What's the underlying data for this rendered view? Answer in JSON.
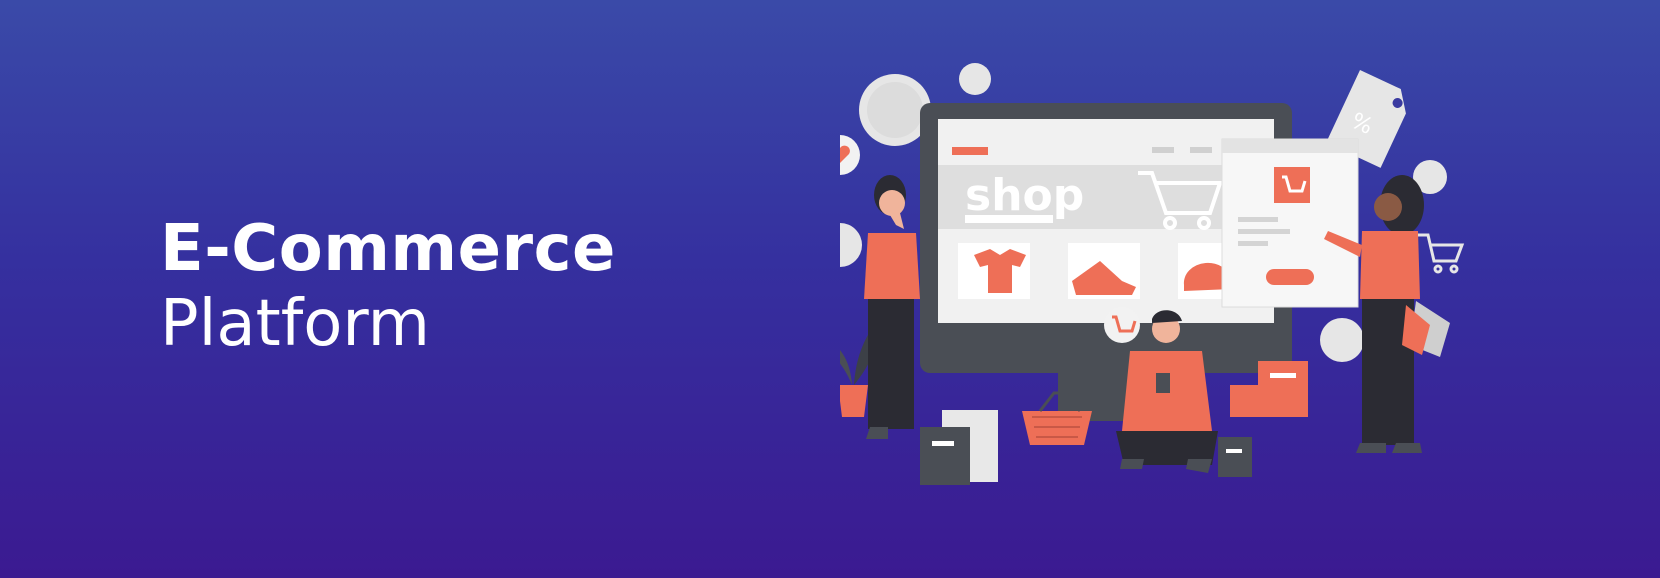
{
  "headline": {
    "title": "E-Commerce",
    "subtitle": "Platform"
  },
  "illustration": {
    "screen_word": "shop"
  },
  "colors": {
    "background_top": "#3a4aa8",
    "background_bottom": "#3b1a91",
    "accent": "#ee6f57",
    "monitor": "#4a4e55",
    "screen": "#f1f1f1"
  },
  "icons": [
    "heart-icon",
    "cart-icon",
    "price-tag-icon",
    "shopping-basket-icon",
    "plant-icon",
    "shopping-bag-icon",
    "gift-box-icon"
  ]
}
